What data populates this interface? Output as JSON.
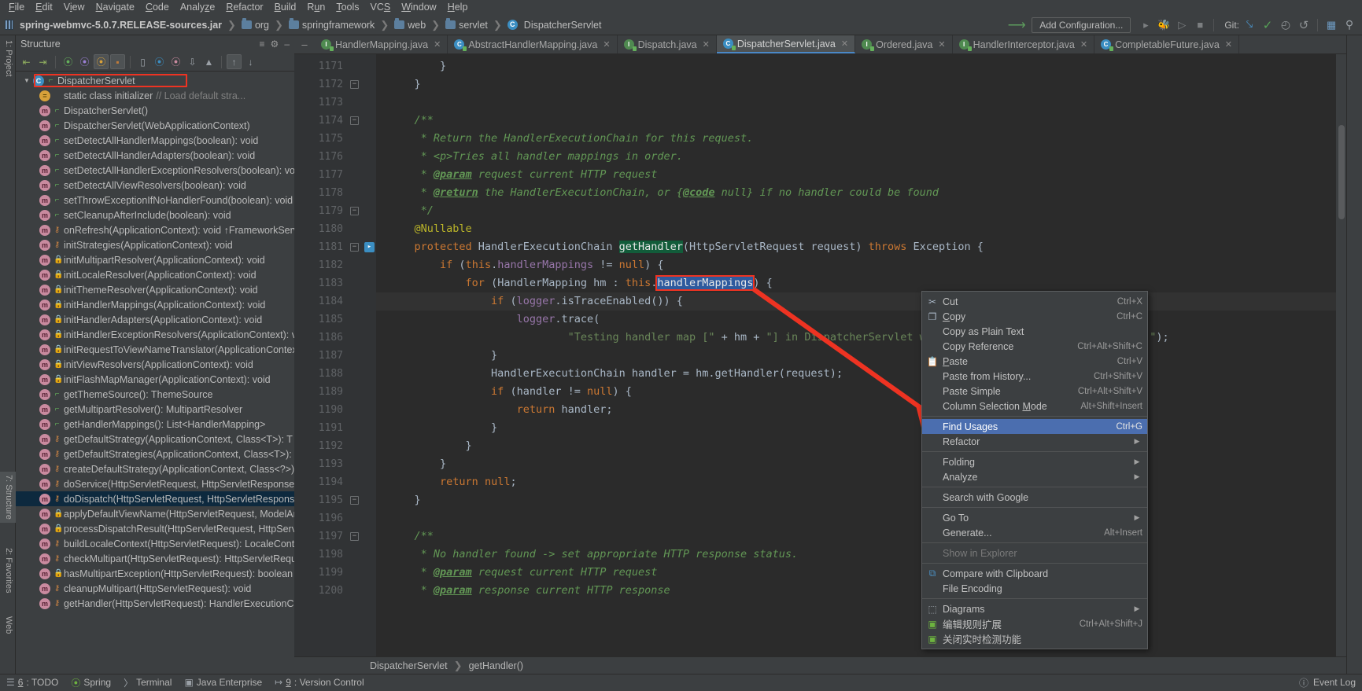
{
  "menubar": [
    "File",
    "Edit",
    "View",
    "Navigate",
    "Code",
    "Analyze",
    "Refactor",
    "Build",
    "Run",
    "Tools",
    "VCS",
    "Window",
    "Help"
  ],
  "breadcrumb": {
    "jar": "spring-webmvc-5.0.7.RELEASE-sources.jar",
    "items": [
      "org",
      "springframework",
      "web",
      "servlet"
    ],
    "current": "DispatcherServlet"
  },
  "toolbar": {
    "add_configuration": "Add Configuration...",
    "git_label": "Git:"
  },
  "structure": {
    "title": "Structure",
    "root": {
      "label": "DispatcherServlet",
      "icon": "class-icon",
      "highlighted": true
    },
    "items": [
      {
        "label": "static class initializer",
        "comment": "// Load default stra...",
        "icon": "static-init-icon",
        "vis": ""
      },
      {
        "label": "DispatcherServlet()",
        "icon": "method-icon",
        "vis": "public"
      },
      {
        "label": "DispatcherServlet(WebApplicationContext)",
        "icon": "method-icon",
        "vis": "public"
      },
      {
        "label": "setDetectAllHandlerMappings(boolean): void",
        "icon": "method-icon",
        "vis": "public"
      },
      {
        "label": "setDetectAllHandlerAdapters(boolean): void",
        "icon": "method-icon",
        "vis": "public"
      },
      {
        "label": "setDetectAllHandlerExceptionResolvers(boolean): void",
        "icon": "method-icon",
        "vis": "public"
      },
      {
        "label": "setDetectAllViewResolvers(boolean): void",
        "icon": "method-icon",
        "vis": "public"
      },
      {
        "label": "setThrowExceptionIfNoHandlerFound(boolean): void",
        "icon": "method-icon",
        "vis": "public"
      },
      {
        "label": "setCleanupAfterInclude(boolean): void",
        "icon": "method-icon",
        "vis": "public"
      },
      {
        "label": "onRefresh(ApplicationContext): void ↑FrameworkServle",
        "icon": "method-icon",
        "vis": "protected"
      },
      {
        "label": "initStrategies(ApplicationContext): void",
        "icon": "method-icon",
        "vis": "protected"
      },
      {
        "label": "initMultipartResolver(ApplicationContext): void",
        "icon": "method-icon",
        "vis": "private"
      },
      {
        "label": "initLocaleResolver(ApplicationContext): void",
        "icon": "method-icon",
        "vis": "private"
      },
      {
        "label": "initThemeResolver(ApplicationContext): void",
        "icon": "method-icon",
        "vis": "private"
      },
      {
        "label": "initHandlerMappings(ApplicationContext): void",
        "icon": "method-icon",
        "vis": "private"
      },
      {
        "label": "initHandlerAdapters(ApplicationContext): void",
        "icon": "method-icon",
        "vis": "private"
      },
      {
        "label": "initHandlerExceptionResolvers(ApplicationContext): voi",
        "icon": "method-icon",
        "vis": "private"
      },
      {
        "label": "initRequestToViewNameTranslator(ApplicationContext)",
        "icon": "method-icon",
        "vis": "private"
      },
      {
        "label": "initViewResolvers(ApplicationContext): void",
        "icon": "method-icon",
        "vis": "private"
      },
      {
        "label": "initFlashMapManager(ApplicationContext): void",
        "icon": "method-icon",
        "vis": "private"
      },
      {
        "label": "getThemeSource(): ThemeSource",
        "icon": "method-icon",
        "vis": "public"
      },
      {
        "label": "getMultipartResolver(): MultipartResolver",
        "icon": "method-icon",
        "vis": "public"
      },
      {
        "label": "getHandlerMappings(): List<HandlerMapping>",
        "icon": "method-icon",
        "vis": "public"
      },
      {
        "label": "getDefaultStrategy(ApplicationContext, Class<T>): T",
        "icon": "method-icon",
        "vis": "protected"
      },
      {
        "label": "getDefaultStrategies(ApplicationContext, Class<T>): Lis",
        "icon": "method-icon",
        "vis": "protected"
      },
      {
        "label": "createDefaultStrategy(ApplicationContext, Class<?>): O",
        "icon": "method-icon",
        "vis": "protected"
      },
      {
        "label": "doService(HttpServletRequest, HttpServletResponse): v",
        "icon": "method-icon",
        "vis": "protected"
      },
      {
        "label": "doDispatch(HttpServletRequest, HttpServletResponse):",
        "icon": "method-icon",
        "vis": "protected",
        "selected": true
      },
      {
        "label": "applyDefaultViewName(HttpServletRequest, ModelAnd",
        "icon": "method-icon",
        "vis": "private"
      },
      {
        "label": "processDispatchResult(HttpServletRequest, HttpServlet",
        "icon": "method-icon",
        "vis": "private"
      },
      {
        "label": "buildLocaleContext(HttpServletRequest): LocaleContext",
        "icon": "method-icon",
        "vis": "protected"
      },
      {
        "label": "checkMultipart(HttpServletRequest): HttpServletReques",
        "icon": "method-icon",
        "vis": "protected"
      },
      {
        "label": "hasMultipartException(HttpServletRequest): boolean",
        "icon": "method-icon",
        "vis": "private"
      },
      {
        "label": "cleanupMultipart(HttpServletRequest): void",
        "icon": "method-icon",
        "vis": "protected"
      },
      {
        "label": "getHandler(HttpServletRequest): HandlerExecutionChai",
        "icon": "method-icon",
        "vis": "protected"
      }
    ]
  },
  "editor_tabs": [
    {
      "label": "HandlerMapping.java",
      "icon": "interface-icon",
      "active": false
    },
    {
      "label": "AbstractHandlerMapping.java",
      "icon": "class-icon",
      "active": false
    },
    {
      "label": "Dispatch.java",
      "icon": "interface-icon",
      "active": false
    },
    {
      "label": "DispatcherServlet.java",
      "icon": "class-icon",
      "active": true
    },
    {
      "label": "Ordered.java",
      "icon": "interface-icon",
      "active": false
    },
    {
      "label": "HandlerInterceptor.java",
      "icon": "interface-icon",
      "active": false
    },
    {
      "label": "CompletableFuture.java",
      "icon": "class-icon",
      "active": false
    }
  ],
  "code": {
    "first_line": 1171,
    "lines": [
      {
        "n": 1171,
        "html": "        }"
      },
      {
        "n": 1172,
        "html": "    }",
        "fold": "minus"
      },
      {
        "n": 1173,
        "html": ""
      },
      {
        "n": 1174,
        "html": "    <c>/**</c>",
        "fold": "minus"
      },
      {
        "n": 1175,
        "html": "     <c>* Return the HandlerExecutionChain for this request.</c>"
      },
      {
        "n": 1176,
        "html": "     <c>* &lt;p&gt;Tries all handler mappings in order.</c>"
      },
      {
        "n": 1177,
        "html": "     <c>* </c><t>@param</t><c> request current HTTP request</c>"
      },
      {
        "n": 1178,
        "html": "     <c>* </c><t>@return</t><c> the HandlerExecutionChain, or {</c><t>@code</t><c> null} if no handler could be found</c>"
      },
      {
        "n": 1179,
        "html": "     <c>*/</c>",
        "fold": "end"
      },
      {
        "n": 1180,
        "html": "    <a>@Nullable</a>"
      },
      {
        "n": 1181,
        "html": "    <k>protected</k> HandlerExecutionChain <m>getHandler</m>(HttpServletRequest request) <k>throws</k> Exception {",
        "fold": "minus",
        "run": true
      },
      {
        "n": 1182,
        "html": "        <k>if</k> (<k>this</k>.<f>handlerMappings</f> != <k>null</k>) {"
      },
      {
        "n": 1183,
        "html": "            <k>for</k> (HandlerMapping hm : <k>this</k>.<s>handlerMappings</s>) {",
        "selected_token": "handlerMappings"
      },
      {
        "n": 1184,
        "html": "                <k>if</k> (<f>logger</f>.isTraceEnabled()) {",
        "hl": true
      },
      {
        "n": 1185,
        "html": "                    <f>logger</f>.trace("
      },
      {
        "n": 1186,
        "html": "                            <q>\"Testing handler map [\"</q> + hm + <q>\"] in DispatcherServlet with name '\"</q> + getServletName() + <q>\"'\"</q>);"
      },
      {
        "n": 1187,
        "html": "                }"
      },
      {
        "n": 1188,
        "html": "                HandlerExecutionChain handler = hm.getHandler(request);"
      },
      {
        "n": 1189,
        "html": "                <k>if</k> (handler != <k>null</k>) {"
      },
      {
        "n": 1190,
        "html": "                    <k>return</k> handler;"
      },
      {
        "n": 1191,
        "html": "                }"
      },
      {
        "n": 1192,
        "html": "            }"
      },
      {
        "n": 1193,
        "html": "        }"
      },
      {
        "n": 1194,
        "html": "        <k>return</k> <k>null</k>;"
      },
      {
        "n": 1195,
        "html": "    }",
        "fold": "end"
      },
      {
        "n": 1196,
        "html": ""
      },
      {
        "n": 1197,
        "html": "    <c>/**</c>",
        "fold": "minus"
      },
      {
        "n": 1198,
        "html": "     <c>* No handler found -&gt; set appropriate HTTP response status.</c>"
      },
      {
        "n": 1199,
        "html": "     <c>* </c><t>@param</t><c> request current HTTP request</c>"
      },
      {
        "n": 1200,
        "html": "     <c>* </c><t>@param</t><c> response current HTTP response</c>"
      }
    ],
    "breadcrumbs": [
      "DispatcherServlet",
      "getHandler()"
    ]
  },
  "context_menu": [
    {
      "label": "Cut",
      "key": "Ctrl+X",
      "icon": "scissors-icon",
      "mnemonic": ""
    },
    {
      "label": "Copy",
      "key": "Ctrl+C",
      "icon": "copy-icon",
      "mnemonic": "C"
    },
    {
      "label": "Copy as Plain Text",
      "key": "",
      "icon": "",
      "mnemonic": ""
    },
    {
      "label": "Copy Reference",
      "key": "Ctrl+Alt+Shift+C",
      "icon": "",
      "mnemonic": ""
    },
    {
      "label": "Paste",
      "key": "Ctrl+V",
      "icon": "clipboard-icon",
      "mnemonic": "P"
    },
    {
      "label": "Paste from History...",
      "key": "Ctrl+Shift+V",
      "icon": "",
      "mnemonic": ""
    },
    {
      "label": "Paste Simple",
      "key": "Ctrl+Alt+Shift+V",
      "icon": "",
      "mnemonic": ""
    },
    {
      "label": "Column Selection Mode",
      "key": "Alt+Shift+Insert",
      "icon": "",
      "mnemonic": "M"
    },
    {
      "sep": true
    },
    {
      "label": "Find Usages",
      "key": "Ctrl+G",
      "icon": "",
      "selected": true
    },
    {
      "label": "Refactor",
      "key": "",
      "icon": "",
      "submenu": true
    },
    {
      "sep": true
    },
    {
      "label": "Folding",
      "key": "",
      "icon": "",
      "submenu": true
    },
    {
      "label": "Analyze",
      "key": "",
      "icon": "",
      "submenu": true
    },
    {
      "sep": true
    },
    {
      "label": "Search with Google",
      "key": "",
      "icon": ""
    },
    {
      "sep": true
    },
    {
      "label": "Go To",
      "key": "",
      "icon": "",
      "submenu": true
    },
    {
      "label": "Generate...",
      "key": "Alt+Insert",
      "icon": ""
    },
    {
      "sep": true
    },
    {
      "label": "Show in Explorer",
      "key": "",
      "icon": "",
      "disabled": true
    },
    {
      "sep": true
    },
    {
      "label": "Compare with Clipboard",
      "key": "",
      "icon": "compare-icon"
    },
    {
      "label": "File Encoding",
      "key": "",
      "icon": ""
    },
    {
      "sep": true
    },
    {
      "label": "Diagrams",
      "key": "",
      "icon": "diagram-icon",
      "submenu": true
    },
    {
      "label": "编辑规则扩展",
      "key": "Ctrl+Alt+Shift+J",
      "icon": "green-icon"
    },
    {
      "label": "关闭实时检测功能",
      "key": "",
      "icon": "green-icon"
    }
  ],
  "statusbar": {
    "items": [
      {
        "num": "6",
        "label": ": TODO",
        "icon": "todo-icon"
      },
      {
        "num": "",
        "label": "Spring",
        "icon": "spring-icon"
      },
      {
        "num": "",
        "label": "Terminal",
        "icon": "terminal-icon"
      },
      {
        "num": "",
        "label": "Java Enterprise",
        "icon": "java-ee-icon"
      },
      {
        "num": "9",
        "label": ": Version Control",
        "icon": "vcs-icon"
      }
    ],
    "right": {
      "event_log": "Event Log",
      "icon": "event-log-icon"
    }
  },
  "left_tool_tabs": [
    {
      "label": "1: Project"
    },
    {
      "label": "7: Structure"
    },
    {
      "label": "2: Favorites"
    },
    {
      "label": "Web"
    }
  ],
  "colors": {
    "accent": "#4b6eaf",
    "annotation_red": "#ee3322",
    "selection_blue": "#2e5a9e",
    "method_green": "#125c3a",
    "panel_bg": "#3c3f41",
    "editor_bg": "#2b2b2b"
  }
}
